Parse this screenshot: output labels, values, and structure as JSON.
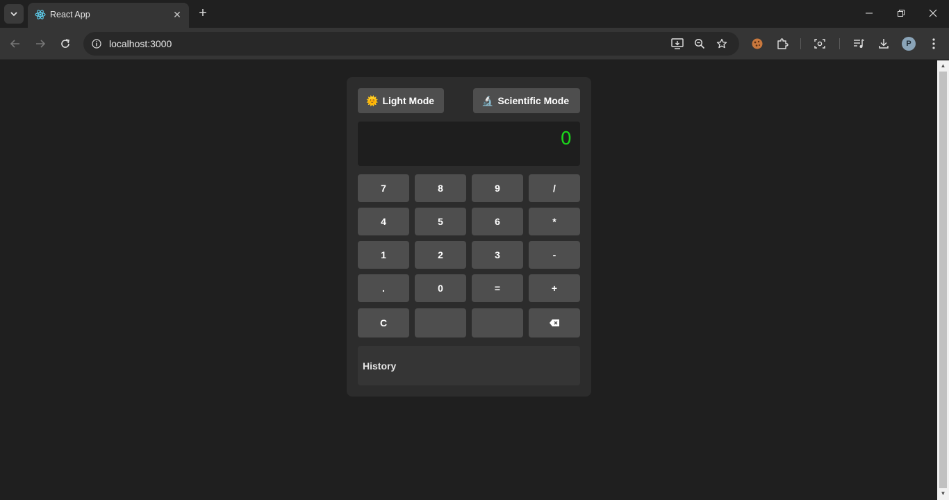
{
  "browser": {
    "tab_title": "React App",
    "url": "localhost:3000",
    "profile_initial": "P"
  },
  "calculator": {
    "light_mode_label": "Light Mode",
    "light_mode_emoji": "🌞",
    "scientific_mode_label": "Scientific Mode",
    "scientific_mode_emoji": "🔬",
    "display_value": "0",
    "display_color": "#1bd51b",
    "keys": {
      "k7": "7",
      "k8": "8",
      "k9": "9",
      "div": "/",
      "k4": "4",
      "k5": "5",
      "k6": "6",
      "mul": "*",
      "k1": "1",
      "k2": "2",
      "k3": "3",
      "sub": "-",
      "dot": ".",
      "k0": "0",
      "eq": "=",
      "add": "+",
      "clear": "C",
      "backspace": "⌫"
    },
    "history_label": "History"
  }
}
